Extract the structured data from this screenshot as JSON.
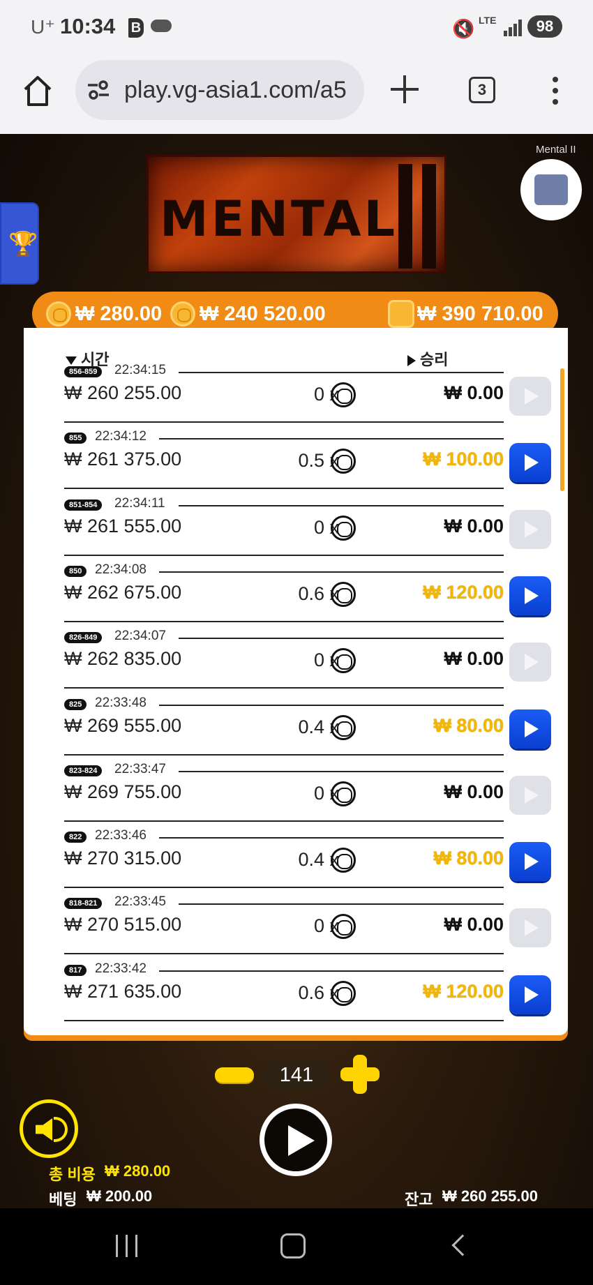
{
  "status_bar": {
    "carrier": "U⁺",
    "time": "10:34",
    "b_letter": "B",
    "lte": "LTE",
    "battery": "98"
  },
  "browser": {
    "url": "play.vg-asia1.com/a5",
    "tab_count": "3"
  },
  "game": {
    "title": "Mental II",
    "logo_text": "MENTAL",
    "balances": {
      "bet": "₩ 280.00",
      "jackpot": "₩ 240 520.00",
      "wallet": "₩ 390 710.00"
    },
    "headers": {
      "time": "시간",
      "win": "승리"
    },
    "rows": [
      {
        "tag": "856-859",
        "time": "22:34:15",
        "bet": "₩ 260 255.00",
        "mult": "0 x",
        "win": "₩ 0.00",
        "won": false
      },
      {
        "tag": "855",
        "time": "22:34:12",
        "bet": "₩ 261 375.00",
        "mult": "0.5 x",
        "win": "₩ 100.00",
        "won": true
      },
      {
        "tag": "851-854",
        "time": "22:34:11",
        "bet": "₩ 261 555.00",
        "mult": "0 x",
        "win": "₩ 0.00",
        "won": false
      },
      {
        "tag": "850",
        "time": "22:34:08",
        "bet": "₩ 262 675.00",
        "mult": "0.6 x",
        "win": "₩ 120.00",
        "won": true
      },
      {
        "tag": "826-849",
        "time": "22:34:07",
        "bet": "₩ 262 835.00",
        "mult": "0 x",
        "win": "₩ 0.00",
        "won": false
      },
      {
        "tag": "825",
        "time": "22:33:48",
        "bet": "₩ 269 555.00",
        "mult": "0.4 x",
        "win": "₩ 80.00",
        "won": true
      },
      {
        "tag": "823-824",
        "time": "22:33:47",
        "bet": "₩ 269 755.00",
        "mult": "0 x",
        "win": "₩ 0.00",
        "won": false
      },
      {
        "tag": "822",
        "time": "22:33:46",
        "bet": "₩ 270 315.00",
        "mult": "0.4 x",
        "win": "₩ 80.00",
        "won": true
      },
      {
        "tag": "818-821",
        "time": "22:33:45",
        "bet": "₩ 270 515.00",
        "mult": "0 x",
        "win": "₩ 0.00",
        "won": false
      },
      {
        "tag": "817",
        "time": "22:33:42",
        "bet": "₩ 271 635.00",
        "mult": "0.6 x",
        "win": "₩ 120.00",
        "won": true
      }
    ],
    "spin_count": "141",
    "footer": {
      "total_cost_label": "총 비용",
      "total_cost": "₩ 280.00",
      "bet_label": "베팅",
      "bet": "₩ 200.00",
      "balance_label": "잔고",
      "balance": "₩ 260 255.00"
    }
  },
  "colors": {
    "accent_orange": "#f08c16",
    "win_gold": "#f2b705",
    "replay_blue": "#1b5cf5"
  }
}
